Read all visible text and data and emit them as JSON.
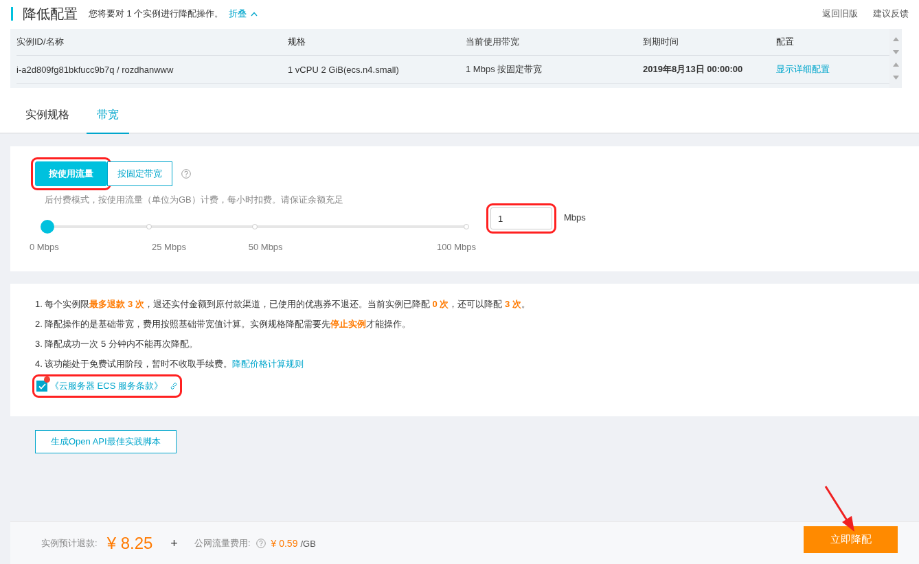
{
  "header": {
    "title": "降低配置",
    "subtitle": "您将要对 1 个实例进行降配操作。",
    "collapse_link": "折叠",
    "links": [
      "返回旧版",
      "建议反馈"
    ]
  },
  "table": {
    "columns": [
      "实例ID/名称",
      "规格",
      "当前使用带宽",
      "到期时间",
      "配置"
    ],
    "rows": [
      {
        "id_name": "i-a2d809fg81bkfucc9b7q / rozdhanwww",
        "spec": "1 vCPU 2 GiB(ecs.n4.small)",
        "bandwidth": "1 Mbps 按固定带宽",
        "expiry": "2019年8月13日 00:00:00",
        "config_link": "显示详细配置"
      }
    ]
  },
  "tabs": [
    {
      "label": "实例规格",
      "selected": false
    },
    {
      "label": "带宽",
      "selected": true
    }
  ],
  "billing": {
    "options": [
      {
        "label": "按使用流量",
        "selected": true
      },
      {
        "label": "按固定带宽",
        "selected": false
      }
    ],
    "hint": "后付费模式，按使用流量（单位为GB）计费，每小时扣费。请保证余额充足"
  },
  "slider": {
    "level": 0.01,
    "ticks": [
      "0 Mbps",
      "25 Mbps",
      "50 Mbps",
      "100 Mbps"
    ],
    "value": "1",
    "unit": "Mbps"
  },
  "notes": [
    {
      "text": "1. 每个实例限**最多退款 3 次**，退还实付金额到原付款渠道，已使用的优惠券不退还。当前实例已降配 **0 次**，还可以降配 **3 次**。"
    },
    {
      "text": "2. 降配操作的是基础带宽，费用按照基础带宽值计算。实例规格降配需要先**停止实例**才能操作。"
    },
    {
      "text": "3. 降配成功一次 5 分钟内不能再次降配。"
    },
    {
      "text": "4. 该功能处于免费试用阶段，暂时不收取手续费。",
      "link": "降配价格计算规则"
    }
  ],
  "agreement": {
    "checked": true,
    "label": "《云服务器 ECS 服务条款》"
  },
  "api_button": "生成Open API最佳实践脚本",
  "footer": {
    "refund_label": "实例预计退款:",
    "refund_amount": "¥ 8.25",
    "plus": "+",
    "traffic_label": "公网流量费用:",
    "traffic_price": "¥ 0.59",
    "traffic_unit": "/GB",
    "submit": "立即降配"
  }
}
